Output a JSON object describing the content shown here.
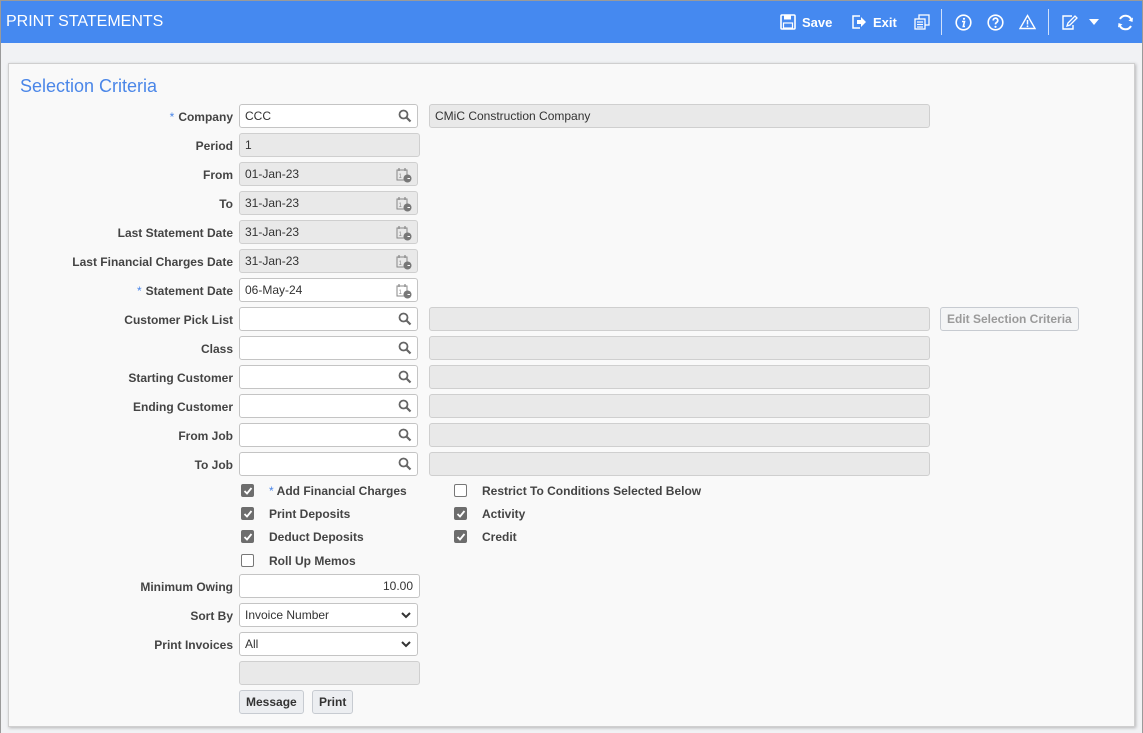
{
  "header": {
    "title": "PRINT STATEMENTS",
    "toolbar": {
      "save_label": "Save",
      "exit_label": "Exit",
      "icons": [
        "save-icon",
        "exit-icon",
        "copy-icon",
        "info-icon",
        "help-icon",
        "warning-icon",
        "edit-icon",
        "dropdown-icon",
        "refresh-icon"
      ]
    },
    "accent_color": "#4589f0"
  },
  "section": {
    "title": "Selection Criteria"
  },
  "form": {
    "company": {
      "label": "Company",
      "required": "*",
      "value": "CCC",
      "description": "CMiC Construction Company"
    },
    "period": {
      "label": "Period",
      "value": "1"
    },
    "from": {
      "label": "From",
      "value": "01-Jan-23"
    },
    "to": {
      "label": "To",
      "value": "31-Jan-23"
    },
    "last_statement_date": {
      "label": "Last Statement Date",
      "value": "31-Jan-23"
    },
    "last_financial_charges_date": {
      "label": "Last Financial Charges Date",
      "value": "31-Jan-23"
    },
    "statement_date": {
      "label": "Statement Date",
      "required": "*",
      "value": "06-May-24"
    },
    "customer_pick_list": {
      "label": "Customer Pick List",
      "value": "",
      "description": ""
    },
    "class": {
      "label": "Class",
      "value": "",
      "description": ""
    },
    "starting_customer": {
      "label": "Starting Customer",
      "value": "",
      "description": ""
    },
    "ending_customer": {
      "label": "Ending Customer",
      "value": "",
      "description": ""
    },
    "from_job": {
      "label": "From Job",
      "value": "",
      "description": ""
    },
    "to_job": {
      "label": "To Job",
      "value": "",
      "description": ""
    },
    "edit_selection_criteria_label": "Edit Selection Criteria",
    "checkboxes_left": [
      {
        "label": "Add Financial Charges",
        "required": "*",
        "checked": true
      },
      {
        "label": "Print Deposits",
        "checked": true
      },
      {
        "label": "Deduct Deposits",
        "checked": true
      },
      {
        "label": "Roll Up Memos",
        "checked": false
      }
    ],
    "checkboxes_right": [
      {
        "label": "Restrict To Conditions Selected Below",
        "checked": false
      },
      {
        "label": "Activity",
        "checked": true
      },
      {
        "label": "Credit",
        "checked": true
      }
    ],
    "minimum_owing": {
      "label": "Minimum Owing",
      "value": "10.00"
    },
    "sort_by": {
      "label": "Sort By",
      "value": "Invoice Number"
    },
    "print_invoices": {
      "label": "Print Invoices",
      "value": "All"
    },
    "message_field": {
      "value": ""
    },
    "message_button": "Message",
    "print_button": "Print"
  }
}
